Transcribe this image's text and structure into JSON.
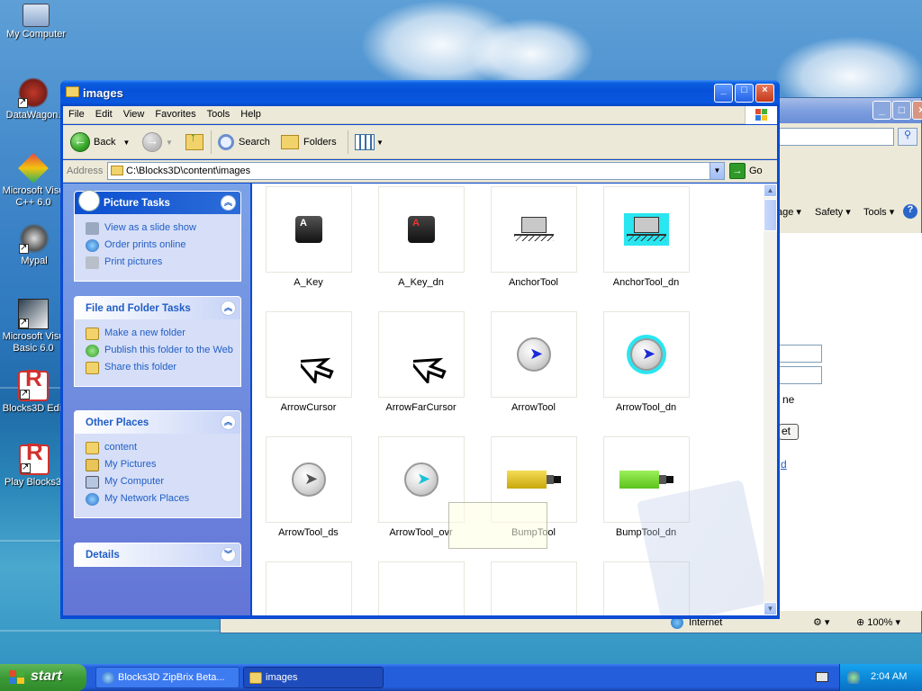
{
  "desktop": {
    "icons": [
      {
        "label": "My Computer"
      },
      {
        "label": "DataWagon."
      },
      {
        "label": "Microsoft Visu C++ 6.0"
      },
      {
        "label": "Mypal"
      },
      {
        "label": "Microsoft Visu Basic 6.0"
      },
      {
        "label": "Blocks3D Edit"
      },
      {
        "label": "Play Blocks3I"
      }
    ]
  },
  "background_window": {
    "safety_label": "Safety",
    "tools_label": "Tools",
    "page_label": "age",
    "partial_text_1": "ne",
    "partial_text_2": "et",
    "partial_link": "d",
    "status_zone": "Internet",
    "zoom": "100%"
  },
  "window": {
    "title": "images",
    "menu": [
      "File",
      "Edit",
      "View",
      "Favorites",
      "Tools",
      "Help"
    ],
    "toolbar": {
      "back": "Back",
      "search": "Search",
      "folders": "Folders"
    },
    "address": {
      "label": "Address",
      "value": "C:\\Blocks3D\\content\\images",
      "go": "Go"
    },
    "task_pane": {
      "picture_tasks": {
        "title": "Picture Tasks",
        "links": [
          "View as a slide show",
          "Order prints online",
          "Print pictures"
        ]
      },
      "file_folder_tasks": {
        "title": "File and Folder Tasks",
        "links": [
          "Make a new folder",
          "Publish this folder to the Web",
          "Share this folder"
        ]
      },
      "other_places": {
        "title": "Other Places",
        "links": [
          "content",
          "My Pictures",
          "My Computer",
          "My Network Places"
        ]
      },
      "details": {
        "title": "Details"
      }
    },
    "files": [
      "A_Key",
      "A_Key_dn",
      "AnchorTool",
      "AnchorTool_dn",
      "ArrowCursor",
      "ArrowFarCursor",
      "ArrowTool",
      "ArrowTool_dn",
      "ArrowTool_ds",
      "ArrowTool_ovr",
      "BumpTool",
      "BumpTool_dn",
      "",
      "",
      "",
      ""
    ]
  },
  "taskbar": {
    "start": "start",
    "items": [
      "Blocks3D ZipBrix Beta...",
      "images"
    ],
    "clock": "2:04 AM"
  },
  "colors": {
    "xp_blue": "#0a4bd4",
    "start_green": "#3c9b36",
    "link_blue": "#215dc6"
  }
}
